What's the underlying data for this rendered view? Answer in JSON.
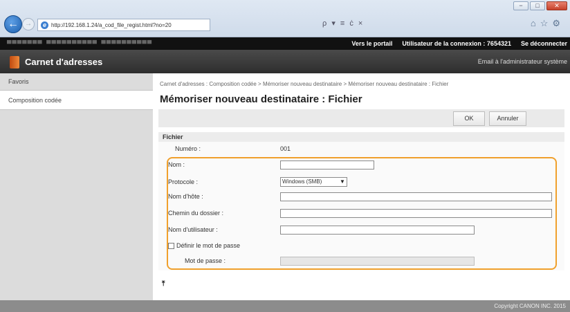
{
  "browser": {
    "url": "http://192.168.1.24/a_cod_file_regist.html?no=20",
    "address_tools": "ρ ▾ ≡ ċ ×",
    "window_buttons": [
      "−",
      "□",
      "✕"
    ]
  },
  "header": {
    "portal_link": "Vers le portail",
    "login_user": "Utilisateur de la connexion :  7654321",
    "logout_link": "Se déconnecter",
    "app_title": "Carnet d'adresses",
    "admin_email": "Email à l'administrateur système"
  },
  "sidebar": {
    "items": [
      {
        "label": "Favoris"
      },
      {
        "label": "Composition codée"
      }
    ]
  },
  "main": {
    "breadcrumb": "Carnet d'adresses : Composition codée > Mémoriser nouveau destinataire > Mémoriser nouveau destinataire : Fichier",
    "title": "Mémoriser nouveau destinataire : Fichier",
    "ok_label": "OK",
    "cancel_label": "Annuler",
    "section_title": "Fichier",
    "fields": {
      "numero_label": "Numéro :",
      "numero_value": "001",
      "nom_label": "Nom :",
      "protocole_label": "Protocole :",
      "protocole_value": "Windows (SMB)",
      "hote_label": "Nom d'hôte :",
      "chemin_label": "Chemin du dossier :",
      "utilisateur_label": "Nom d'utilisateur :",
      "definir_label": "Définir le mot de passe",
      "motdepasse_label": "Mot de passe :"
    }
  },
  "footer": {
    "copyright": "Copyright CANON INC. 2015"
  }
}
